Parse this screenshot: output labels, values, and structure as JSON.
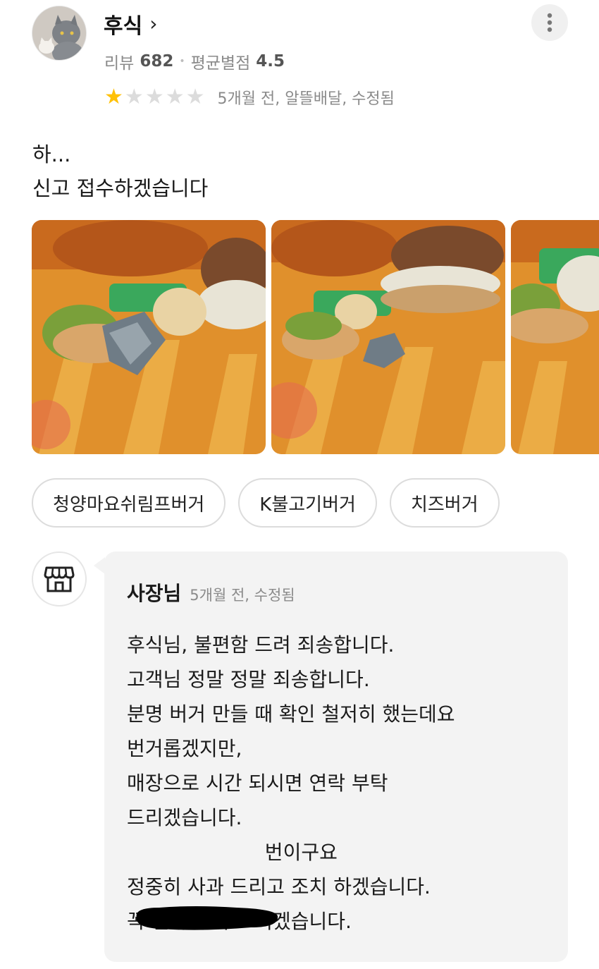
{
  "reviewer": {
    "name": "후식",
    "chevron": "›",
    "review_label": "리뷰",
    "review_count": "682",
    "separator": "•",
    "avg_label": "평균별점",
    "avg_rating": "4.5"
  },
  "more_button": {
    "icon": "more-vertical-icon"
  },
  "rating": {
    "stars_filled": 1,
    "stars_total": 5,
    "meta": "5개월 전, 알뜰배달, 수정됨"
  },
  "review": {
    "lines": [
      "하...",
      "신고 접수하겠습니다"
    ]
  },
  "photos": {
    "count": 3
  },
  "tags": [
    "청양마요쉬림프버거",
    "K불고기버거",
    "치즈버거"
  ],
  "owner_reply": {
    "icon": "storefront-icon",
    "name": "사장님",
    "meta": "5개월 전, 수정됨",
    "lines": [
      "후식님, 불편함 드려 죄송합니다.",
      "고객님 정말 정말 죄송합니다.",
      "분명 버거 만들 때 확인 철저히 했는데요",
      "번거롭겠지만,",
      "매장으로 시간 되시면 연락 부탁",
      "드리겠습니다.",
      "                      번이구요",
      "정중히 사과 드리고 조치 하겠습니다.",
      "꼭 연락 부탁 드리겠습니다."
    ]
  },
  "colors": {
    "star_on": "#ffc107",
    "star_off": "#dcdcdc",
    "reply_bg": "#f3f3f3",
    "muted_text": "#8a8a8a"
  }
}
